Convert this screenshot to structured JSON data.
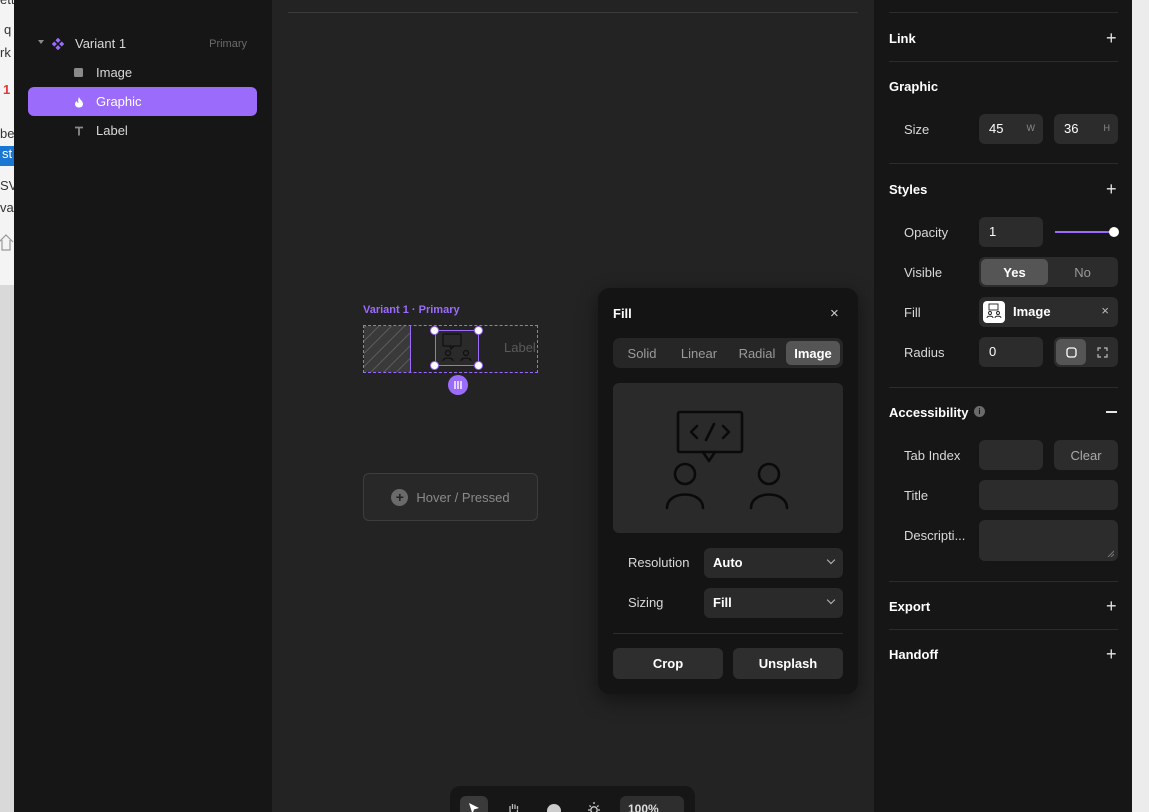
{
  "background_window": {
    "fragments": [
      "ette",
      "q",
      "rk",
      "1",
      "be",
      "st",
      "SV",
      "va"
    ]
  },
  "layers": {
    "items": [
      {
        "label": "Variant 1",
        "tag": "Primary"
      },
      {
        "label": "Image"
      },
      {
        "label": "Graphic"
      },
      {
        "label": "Label"
      }
    ]
  },
  "canvas": {
    "variant_label": "Variant 1 · Primary",
    "label_fragment": "Label",
    "hover_button": "Hover / Pressed",
    "zoom": "100%"
  },
  "fill_popover": {
    "title": "Fill",
    "close": "×",
    "tabs": [
      "Solid",
      "Linear",
      "Radial",
      "Image"
    ],
    "active_tab": "Image",
    "resolution_label": "Resolution",
    "resolution_value": "Auto",
    "sizing_label": "Sizing",
    "sizing_value": "Fill",
    "crop_label": "Crop",
    "unsplash_label": "Unsplash"
  },
  "properties": {
    "link": {
      "title": "Link"
    },
    "graphic": {
      "title": "Graphic",
      "size_label": "Size",
      "width": "45",
      "width_unit": "W",
      "height": "36",
      "height_unit": "H"
    },
    "styles": {
      "title": "Styles",
      "opacity_label": "Opacity",
      "opacity_value": "1",
      "opacity_level": 1.0,
      "visible_label": "Visible",
      "visible_yes": "Yes",
      "visible_no": "No",
      "fill_label": "Fill",
      "fill_value": "Image",
      "fill_remove": "×",
      "radius_label": "Radius",
      "radius_value": "0"
    },
    "accessibility": {
      "title": "Accessibility",
      "info": "i",
      "tab_index_label": "Tab Index",
      "tab_index_value": "",
      "clear_label": "Clear",
      "title_label": "Title",
      "title_value": "",
      "description_label": "Descripti...",
      "description_value": ""
    },
    "export": {
      "title": "Export"
    },
    "handoff": {
      "title": "Handoff"
    }
  },
  "colors": {
    "accent": "#9b6cfb",
    "panel": "#161616",
    "canvas": "#232323"
  }
}
